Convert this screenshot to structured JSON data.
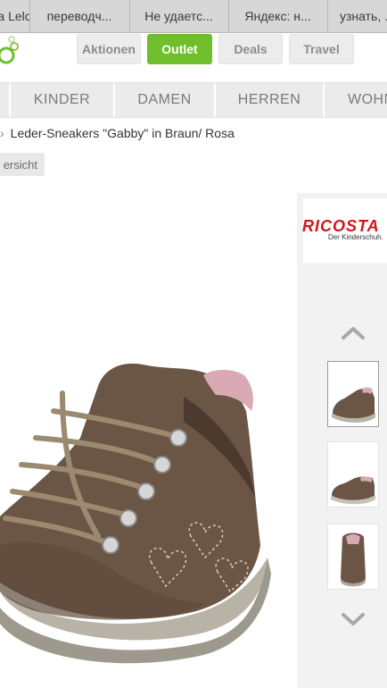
{
  "browser": {
    "tabs": [
      {
        "label": "a Lelo"
      },
      {
        "label": "переводч..."
      },
      {
        "label": "Не удаетс..."
      },
      {
        "label": "Яндекс: н..."
      },
      {
        "label": "узнать, ..."
      }
    ]
  },
  "header": {
    "nav": [
      {
        "label": "Aktionen",
        "active": false
      },
      {
        "label": "Outlet",
        "active": true
      },
      {
        "label": "Deals",
        "active": false
      },
      {
        "label": "Travel",
        "active": false
      }
    ]
  },
  "categories": [
    "KINDER",
    "DAMEN",
    "HERREN",
    "WOHN"
  ],
  "breadcrumb": {
    "separator": "›",
    "current": "Leder-Sneakers \"Gabby\" in Braun/ Rosa"
  },
  "back_button": {
    "label": "ersicht"
  },
  "brand": {
    "name": "RICOSTA",
    "tagline": "Der Kinderschuh."
  },
  "gallery": {
    "thumbnails": [
      "shoe side view",
      "shoe side view 2",
      "shoe back view"
    ],
    "selected_index": 0
  },
  "colors": {
    "accent": "#6fbe2b",
    "brand_red": "#d2141c",
    "shoe_brown": "#6b5646"
  }
}
